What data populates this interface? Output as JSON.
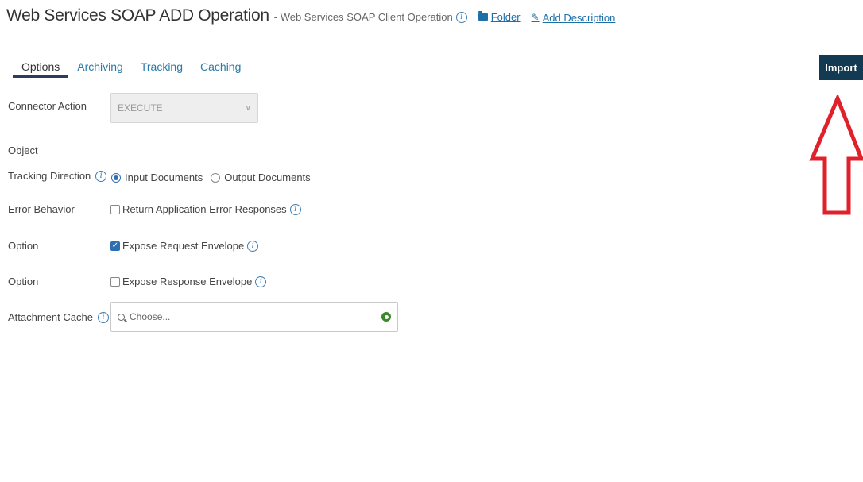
{
  "header": {
    "title": "Web Services SOAP ADD Operation",
    "subtitle": "- Web Services SOAP Client Operation",
    "folder_link": "Folder",
    "add_description_link": "Add Description"
  },
  "tabs": [
    {
      "label": "Options",
      "active": true
    },
    {
      "label": "Archiving"
    },
    {
      "label": "Tracking"
    },
    {
      "label": "Caching"
    }
  ],
  "import_button": "Import",
  "form": {
    "connector_action": {
      "label": "Connector Action",
      "value": "EXECUTE"
    },
    "object": {
      "label": "Object"
    },
    "tracking_direction": {
      "label": "Tracking Direction",
      "options": [
        "Input Documents",
        "Output Documents"
      ],
      "selected": "Input Documents"
    },
    "error_behavior": {
      "label": "Error Behavior",
      "checkbox_label": "Return Application Error Responses",
      "checked": false
    },
    "option_request": {
      "label": "Option",
      "checkbox_label": "Expose Request Envelope",
      "checked": true
    },
    "option_response": {
      "label": "Option",
      "checkbox_label": "Expose Response Envelope",
      "checked": false
    },
    "attachment_cache": {
      "label": "Attachment Cache",
      "placeholder": "Choose..."
    }
  },
  "icons": {
    "info": "info-icon",
    "folder": "folder-icon",
    "pencil": "pencil-icon",
    "search": "search-icon",
    "add": "add-icon",
    "arrow": "up-arrow-annotation"
  },
  "colors": {
    "import_bg": "#123a52",
    "link": "#1d6fa8",
    "arrow": "#e0202a",
    "add_icon": "#3a8a2a"
  }
}
